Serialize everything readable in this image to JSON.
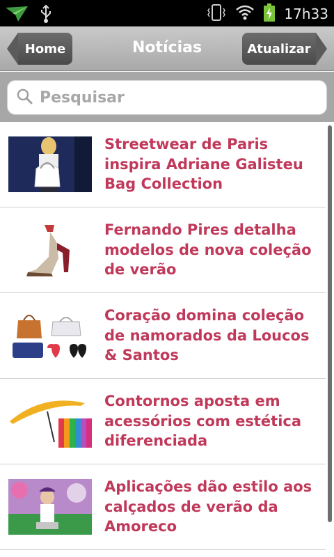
{
  "status_bar": {
    "time": "17h33",
    "icons": [
      "send-icon",
      "usb-icon",
      "vibrate-icon",
      "wifi-icon",
      "battery-charging-icon"
    ]
  },
  "action_bar": {
    "home_label": "Home",
    "title": "Notícias",
    "refresh_label": "Atualizar"
  },
  "search": {
    "placeholder": "Pesquisar",
    "value": ""
  },
  "colors": {
    "headline": "#c0395a",
    "action_bar": "#b5b5b5",
    "button": "#5b5b5b"
  },
  "news": [
    {
      "title": "Streetwear de Paris inspira Adriane Galisteu Bag Collection",
      "thumb": "model-with-bag"
    },
    {
      "title": "Fernando Pires detalha modelos de nova coleção de verão",
      "thumb": "high-heel-sandal"
    },
    {
      "title": "Coração domina coleção de namorados da Loucos & Santos",
      "thumb": "bags-and-heart-purses"
    },
    {
      "title": "Contornos aposta em acessórios com estética diferenciada",
      "thumb": "umbrellas"
    },
    {
      "title": "Aplicações dão estilo aos calçados de verão da Amoreco",
      "thumb": "child-with-shoes"
    }
  ]
}
